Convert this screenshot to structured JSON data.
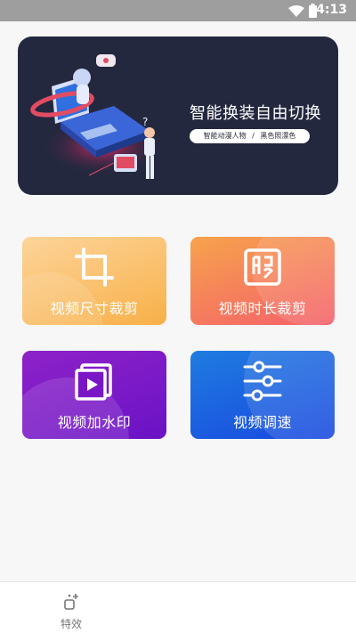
{
  "status_bar": {
    "time": "4:13",
    "icons": [
      "wifi-icon",
      "battery-icon"
    ]
  },
  "banner": {
    "title": "智能换装自由切换",
    "tag_left": "智能动漫人物",
    "tag_sep": "/",
    "tag_right": "黑色照漂色"
  },
  "features": [
    {
      "label": "视频尺寸裁剪",
      "icon": "crop-icon"
    },
    {
      "label": "视频时长裁剪",
      "icon": "seal-icon"
    },
    {
      "label": "视频加水印",
      "icon": "play-frame-icon"
    },
    {
      "label": "视频调速",
      "icon": "sliders-icon"
    }
  ],
  "bottom_nav": {
    "items": [
      {
        "label": "特效",
        "icon": "effects-icon"
      }
    ]
  },
  "colors": {
    "banner_bg": "#24283f",
    "card1": [
      "#fdd49a",
      "#f8b048"
    ],
    "card2": [
      "#f7a34c",
      "#f4606a"
    ],
    "card3": [
      "#8e22c8",
      "#6a12c6"
    ],
    "card4": [
      "#1f7ce0",
      "#1948e0"
    ]
  }
}
